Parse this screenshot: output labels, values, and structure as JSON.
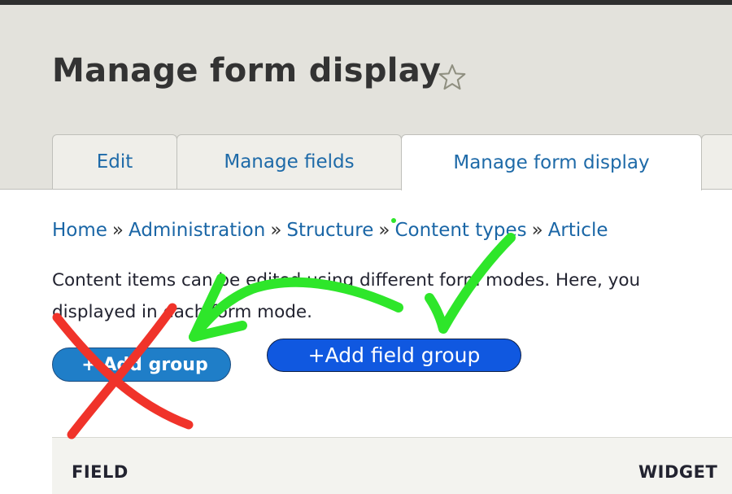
{
  "page": {
    "title": "Manage form display"
  },
  "tabs": [
    {
      "label": "Edit"
    },
    {
      "label": "Manage fields"
    },
    {
      "label": "Manage form display",
      "active": true
    }
  ],
  "breadcrumb": {
    "items": [
      "Home",
      "Administration",
      "Structure",
      "Content types",
      "Article"
    ],
    "separator": "»"
  },
  "description": {
    "line1": "Content items can be edited using different form modes. Here, you",
    "line2": "displayed in each form mode."
  },
  "buttons": {
    "add_group": "+ Add group",
    "add_field_group": "+Add field group"
  },
  "table": {
    "headers": [
      "FIELD",
      "WIDGET"
    ]
  },
  "colors": {
    "link": "#1a66a6",
    "header_bg": "#e3e2dc",
    "annotation_red": "#f0332a",
    "annotation_green": "#2ee62a"
  },
  "icons": {
    "favorite": "star-outline-icon"
  }
}
